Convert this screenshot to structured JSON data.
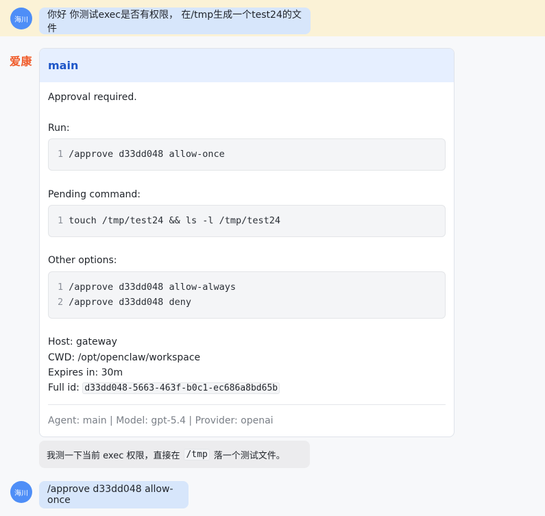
{
  "messages": {
    "user1": {
      "avatar": "海川",
      "text": "你好 你测试exec是否有权限， 在/tmp生成一个test24的文件"
    },
    "bot": {
      "name": "爱康",
      "card_title": "main",
      "approval_required": "Approval required.",
      "run_label": "Run:",
      "run_lines": [
        {
          "n": "1",
          "code": "/approve d33dd048 allow-once"
        }
      ],
      "pending_label": "Pending command:",
      "pending_lines": [
        {
          "n": "1",
          "code": "touch /tmp/test24 && ls -l /tmp/test24"
        }
      ],
      "other_label": "Other options:",
      "other_lines": [
        {
          "n": "1",
          "code": "/approve d33dd048 allow-always"
        },
        {
          "n": "2",
          "code": "/approve d33dd048 deny"
        }
      ],
      "host": "Host: gateway",
      "cwd": "CWD: /opt/openclaw/workspace",
      "expires": "Expires in: 30m",
      "full_id_label": "Full id:",
      "full_id": "d33dd048-5663-463f-b0c1-ec686a8bd65b",
      "footer": "Agent: main | Model: gpt-5.4 | Provider: openai",
      "reply_prefix": "我测一下当前 exec 权限，直接在",
      "reply_code": "/tmp",
      "reply_suffix": "落一个测试文件。"
    },
    "user2": {
      "avatar": "海川",
      "text": "/approve d33dd048 allow-once"
    }
  }
}
